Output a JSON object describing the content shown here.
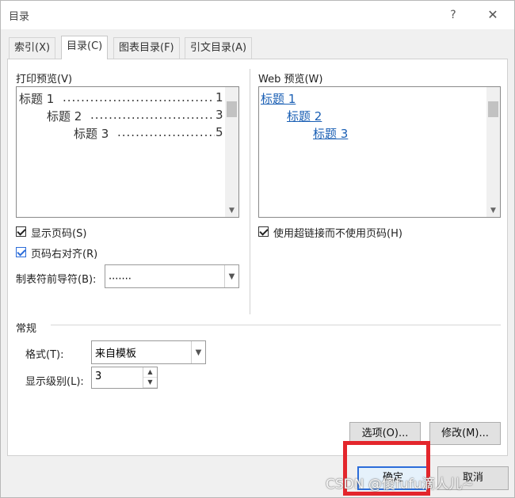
{
  "window": {
    "title": "目录",
    "help": "?",
    "close": "✕"
  },
  "tabs": [
    {
      "label": "索引(X)",
      "active": false
    },
    {
      "label": "目录(C)",
      "active": true
    },
    {
      "label": "图表目录(F)",
      "active": false
    },
    {
      "label": "引文目录(A)",
      "active": false
    }
  ],
  "print_preview": {
    "label": "打印预览(V)",
    "entries": [
      {
        "text": "标题 1",
        "page": "1"
      },
      {
        "text": "标题 2",
        "page": "3"
      },
      {
        "text": "标题 3",
        "page": "5"
      }
    ]
  },
  "web_preview": {
    "label": "Web 预览(W)",
    "links": [
      "标题 1",
      "标题 2",
      "标题 3"
    ]
  },
  "options": {
    "show_page_numbers": {
      "label": "显示页码(S)",
      "checked": true
    },
    "right_align": {
      "label": "页码右对齐(R)",
      "checked": true
    },
    "use_hyperlinks": {
      "label": "使用超链接而不使用页码(H)",
      "checked": true
    },
    "tab_leader_label": "制表符前导符(B):",
    "tab_leader_value": "......."
  },
  "general": {
    "section_label": "常规",
    "format_label": "格式(T):",
    "format_value": "来自模板",
    "levels_label": "显示级别(L):",
    "levels_value": "3"
  },
  "buttons": {
    "options": "选项(O)...",
    "modify": "修改(M)...",
    "ok": "确定",
    "cancel": "取消"
  },
  "watermark": "CSDN @傻fufu滴人儿~",
  "colors": {
    "link": "#1a5fb4",
    "highlight_box": "#e3262c",
    "accent": "#2b6cd9"
  }
}
